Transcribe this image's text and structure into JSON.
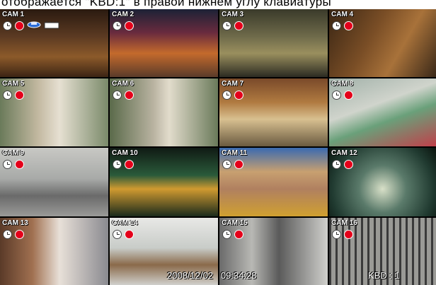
{
  "header": {
    "caption": "отображается \"KBD:1\" в правой нижнем углу клавиатуры"
  },
  "cameras": [
    {
      "label": "CAM 1"
    },
    {
      "label": "CAM 2"
    },
    {
      "label": "CAM 3"
    },
    {
      "label": "CAM 4"
    },
    {
      "label": "CAM 5"
    },
    {
      "label": "CAM 6"
    },
    {
      "label": "CAM 7"
    },
    {
      "label": "CAM 8"
    },
    {
      "label": "CAM 9"
    },
    {
      "label": "CAM 10"
    },
    {
      "label": "CAM 11"
    },
    {
      "label": "CAM 12"
    },
    {
      "label": "CAM 13"
    },
    {
      "label": "CAM 14"
    },
    {
      "label": "CAM 15"
    },
    {
      "label": "CAM 16"
    }
  ],
  "status_icons": [
    "clock-icon",
    "record-icon"
  ],
  "cam1_extra_icons": [
    "ptz-camera-icon",
    "network-icon"
  ],
  "footer": {
    "datetime": "2008/12/02   09:34:28",
    "keyboard": "KBD : 1"
  },
  "colors": {
    "record": "#e4001a",
    "label_text": "#ffffff",
    "grid_background": "#000000"
  }
}
